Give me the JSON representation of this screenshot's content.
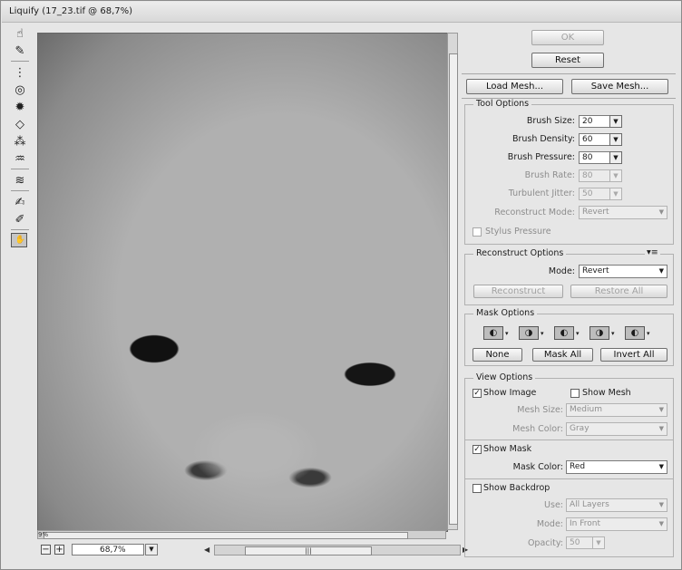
{
  "window": {
    "title": "Liquify (17_23.tif @ 68,7%)"
  },
  "tools": [
    {
      "icon": "forward-warp-icon",
      "glyph": "☝"
    },
    {
      "icon": "reconstruct-icon",
      "glyph": "✎"
    },
    {
      "icon": "smooth-icon",
      "glyph": "⋮"
    },
    {
      "icon": "twirl-clockwise-icon",
      "glyph": "◎"
    },
    {
      "icon": "pucker-icon",
      "glyph": "✹"
    },
    {
      "icon": "bloat-icon",
      "glyph": "◇"
    },
    {
      "icon": "push-left-icon",
      "glyph": "⁂"
    },
    {
      "icon": "mirror-icon",
      "glyph": "♒"
    },
    {
      "icon": "turbulence-icon",
      "glyph": "≋"
    },
    {
      "icon": "freeze-mask-icon",
      "glyph": "✍"
    },
    {
      "icon": "thaw-mask-icon",
      "glyph": "✐"
    },
    {
      "icon": "hand-icon",
      "glyph": "✋"
    },
    {
      "icon": "zoom-icon",
      "glyph": "🔍"
    }
  ],
  "canvas": {
    "hscroll_label": "9%"
  },
  "statusbar": {
    "zoom_value": "68,7%",
    "minus": "−",
    "plus": "+",
    "dropdown": "▼",
    "grip": "|||",
    "left_arrow": "◀",
    "right_arrow": "▶"
  },
  "buttons": {
    "ok": "OK",
    "reset": "Reset",
    "load_mesh": "Load Mesh...",
    "save_mesh": "Save Mesh..."
  },
  "tool_options": {
    "title": "Tool Options",
    "brush_size": {
      "label": "Brush Size:",
      "value": "20"
    },
    "brush_density": {
      "label": "Brush Density:",
      "value": "60"
    },
    "brush_pressure": {
      "label": "Brush Pressure:",
      "value": "80"
    },
    "brush_rate": {
      "label": "Brush Rate:",
      "value": "80"
    },
    "turbulent_jitter": {
      "label": "Turbulent Jitter:",
      "value": "50"
    },
    "reconstruct_mode": {
      "label": "Reconstruct Mode:",
      "value": "Revert"
    },
    "stylus_pressure": {
      "label": "Stylus Pressure"
    }
  },
  "reconstruct_options": {
    "title": "Reconstruct Options",
    "menu_icon": "▾≡",
    "mode": {
      "label": "Mode:",
      "value": "Revert"
    },
    "reconstruct_button": "Reconstruct",
    "restore_all_button": "Restore All"
  },
  "mask_options": {
    "title": "Mask Options",
    "none": "None",
    "mask_all": "Mask All",
    "invert_all": "Invert All",
    "modes": [
      "replace-selection-icon",
      "add-to-selection-icon",
      "subtract-from-selection-icon",
      "intersect-with-selection-icon",
      "invert-selection-icon"
    ]
  },
  "view_options": {
    "title": "View Options",
    "show_image": {
      "label": "Show Image",
      "checked": true
    },
    "show_mesh": {
      "label": "Show Mesh",
      "checked": false
    },
    "mesh_size": {
      "label": "Mesh Size:",
      "value": "Medium"
    },
    "mesh_color": {
      "label": "Mesh Color:",
      "value": "Gray"
    },
    "show_mask": {
      "label": "Show Mask",
      "checked": true
    },
    "mask_color": {
      "label": "Mask Color:",
      "value": "Red"
    },
    "show_backdrop": {
      "label": "Show Backdrop",
      "checked": false
    },
    "use": {
      "label": "Use:",
      "value": "All Layers"
    },
    "mode": {
      "label": "Mode:",
      "value": "In Front"
    },
    "opacity": {
      "label": "Opacity:",
      "value": "50"
    }
  },
  "glyphs": {
    "check": "✓",
    "caret": "▼"
  }
}
